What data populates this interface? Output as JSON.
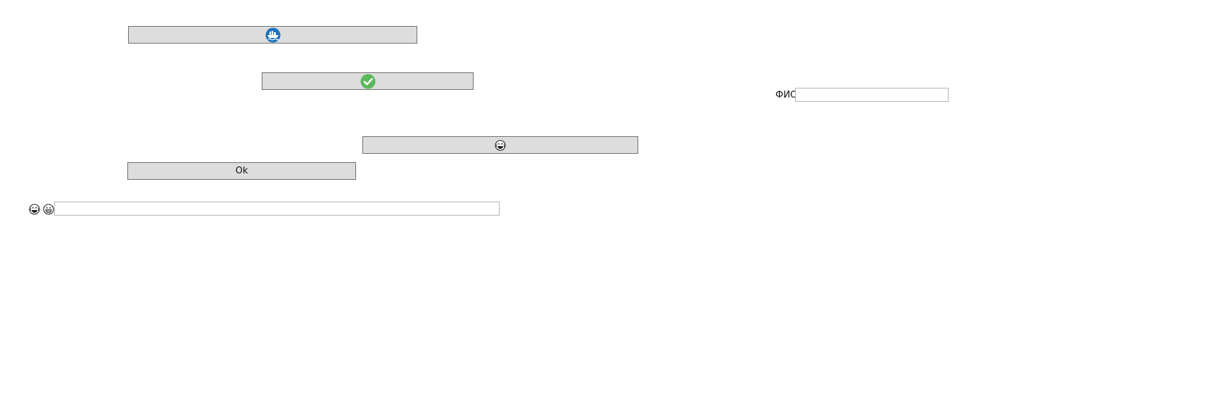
{
  "colors": {
    "button_bg": "#dddddd",
    "button_border": "#6e6e6e",
    "field_border": "#b4b4b4",
    "ship_blue": "#1e73be",
    "check_green": "#5cb85c"
  },
  "buttons": {
    "ship": {
      "icon": "ship-icon"
    },
    "check": {
      "icon": "check-circle-icon"
    },
    "laugh": {
      "icon": "laughing-face-icon"
    },
    "ok": {
      "label": "Ok"
    }
  },
  "fio": {
    "label": "ФИО",
    "value": ""
  },
  "emoji_field": {
    "icons": [
      "laughing-face-icon",
      "grinning-face-icon"
    ],
    "value": ""
  }
}
